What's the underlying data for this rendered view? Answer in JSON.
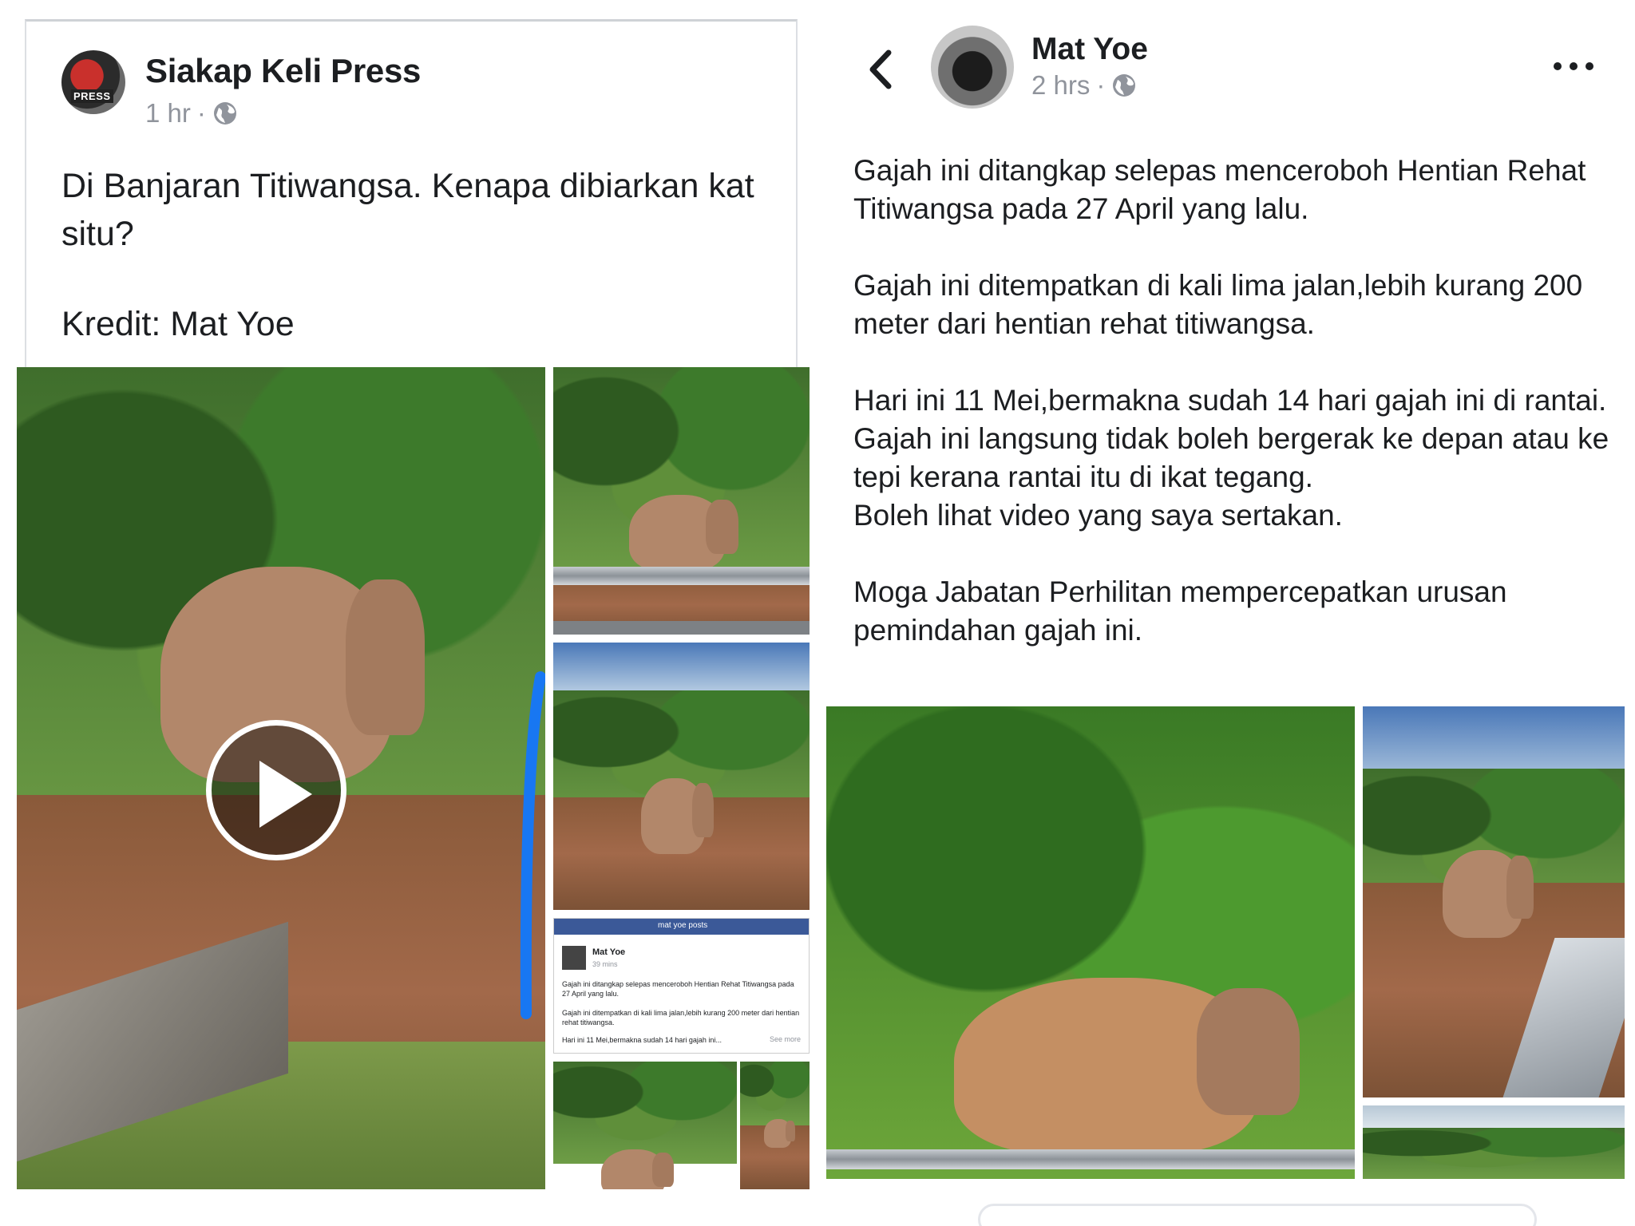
{
  "left_post": {
    "author": "Siakap Keli Press",
    "avatar_text": "PRESS",
    "time": "1 hr",
    "separator": "·",
    "text": "Di Banjaran Titiwangsa. Kenapa dibiarkan kat situ?",
    "credit": "Kredit: Mat Yoe",
    "embedded_screenshot": {
      "search_text": "mat yoe posts",
      "author": "Mat Yoe",
      "time": "39 mins",
      "line1": "Gajah ini ditangkap selepas menceroboh Hentian Rehat Titiwangsa pada 27 April yang lalu.",
      "line2": "Gajah ini ditempatkan di kali lima jalan,lebih kurang 200 meter dari hentian rehat titiwangsa.",
      "line3": "Hari ini 11 Mei,bermakna sudah 14 hari gajah ini...",
      "see_more": "See more"
    }
  },
  "right_post": {
    "author": "Mat Yoe",
    "time": "2 hrs",
    "separator": "·",
    "paragraphs": [
      "Gajah ini ditangkap selepas menceroboh Hentian Rehat Titiwangsa pada 27 April yang lalu.",
      "Gajah ini ditempatkan di kali lima jalan,lebih kurang 200 meter dari hentian rehat titiwangsa.",
      "Hari ini 11 Mei,bermakna sudah 14 hari gajah ini di rantai.",
      "Gajah ini langsung tidak boleh bergerak ke depan atau ke tepi kerana rantai itu di ikat tegang.",
      "Boleh lihat video yang saya sertakan.",
      "Moga Jabatan Perhilitan mempercepatkan urusan pemindahan gajah ini."
    ]
  },
  "icons": {
    "globe": "globe-icon",
    "back": "chevron-left-icon",
    "more": "more-horizontal-icon",
    "play": "play-icon"
  },
  "colors": {
    "text": "#1c1e21",
    "meta": "#90949c",
    "facebook_blue": "#3b5998",
    "arrow_blue": "#1877f2"
  }
}
